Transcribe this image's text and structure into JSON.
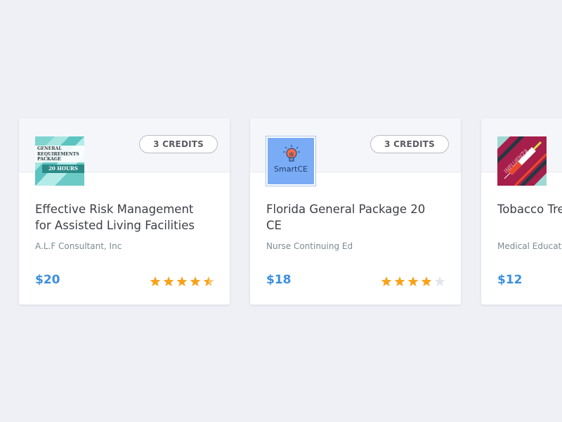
{
  "courses": [
    {
      "credits": "3 CREDITS",
      "thumbnail": {
        "icon": "general-requirements-package-thumbnail",
        "lines": [
          "GENERAL",
          "REQUIREMENTS",
          "PACKAGE"
        ],
        "badge": "20 HOURS"
      },
      "title": "Effective Risk Management for Assisted Living Facilities",
      "provider": "A.L.F Consultant, Inc",
      "price": "$20",
      "rating": 4.5
    },
    {
      "credits": "3 CREDITS",
      "thumbnail": {
        "icon": "smartce-lightbulb-thumbnail",
        "label": "SmartCE"
      },
      "title": "Florida General Package 20 CE",
      "provider": "Nurse Continuing Ed",
      "price": "$18",
      "rating": 4
    },
    {
      "credits": "",
      "thumbnail": {
        "icon": "influenza-syringe-thumbnail",
        "label": "INFLUENZA"
      },
      "title": "Tobacco Tre",
      "provider": "Medical Educatio",
      "price": "$12",
      "rating": null
    }
  ],
  "colors": {
    "star_filled": "#f7a21b",
    "star_empty": "#e3e5ea",
    "price": "#3b8fe0"
  }
}
